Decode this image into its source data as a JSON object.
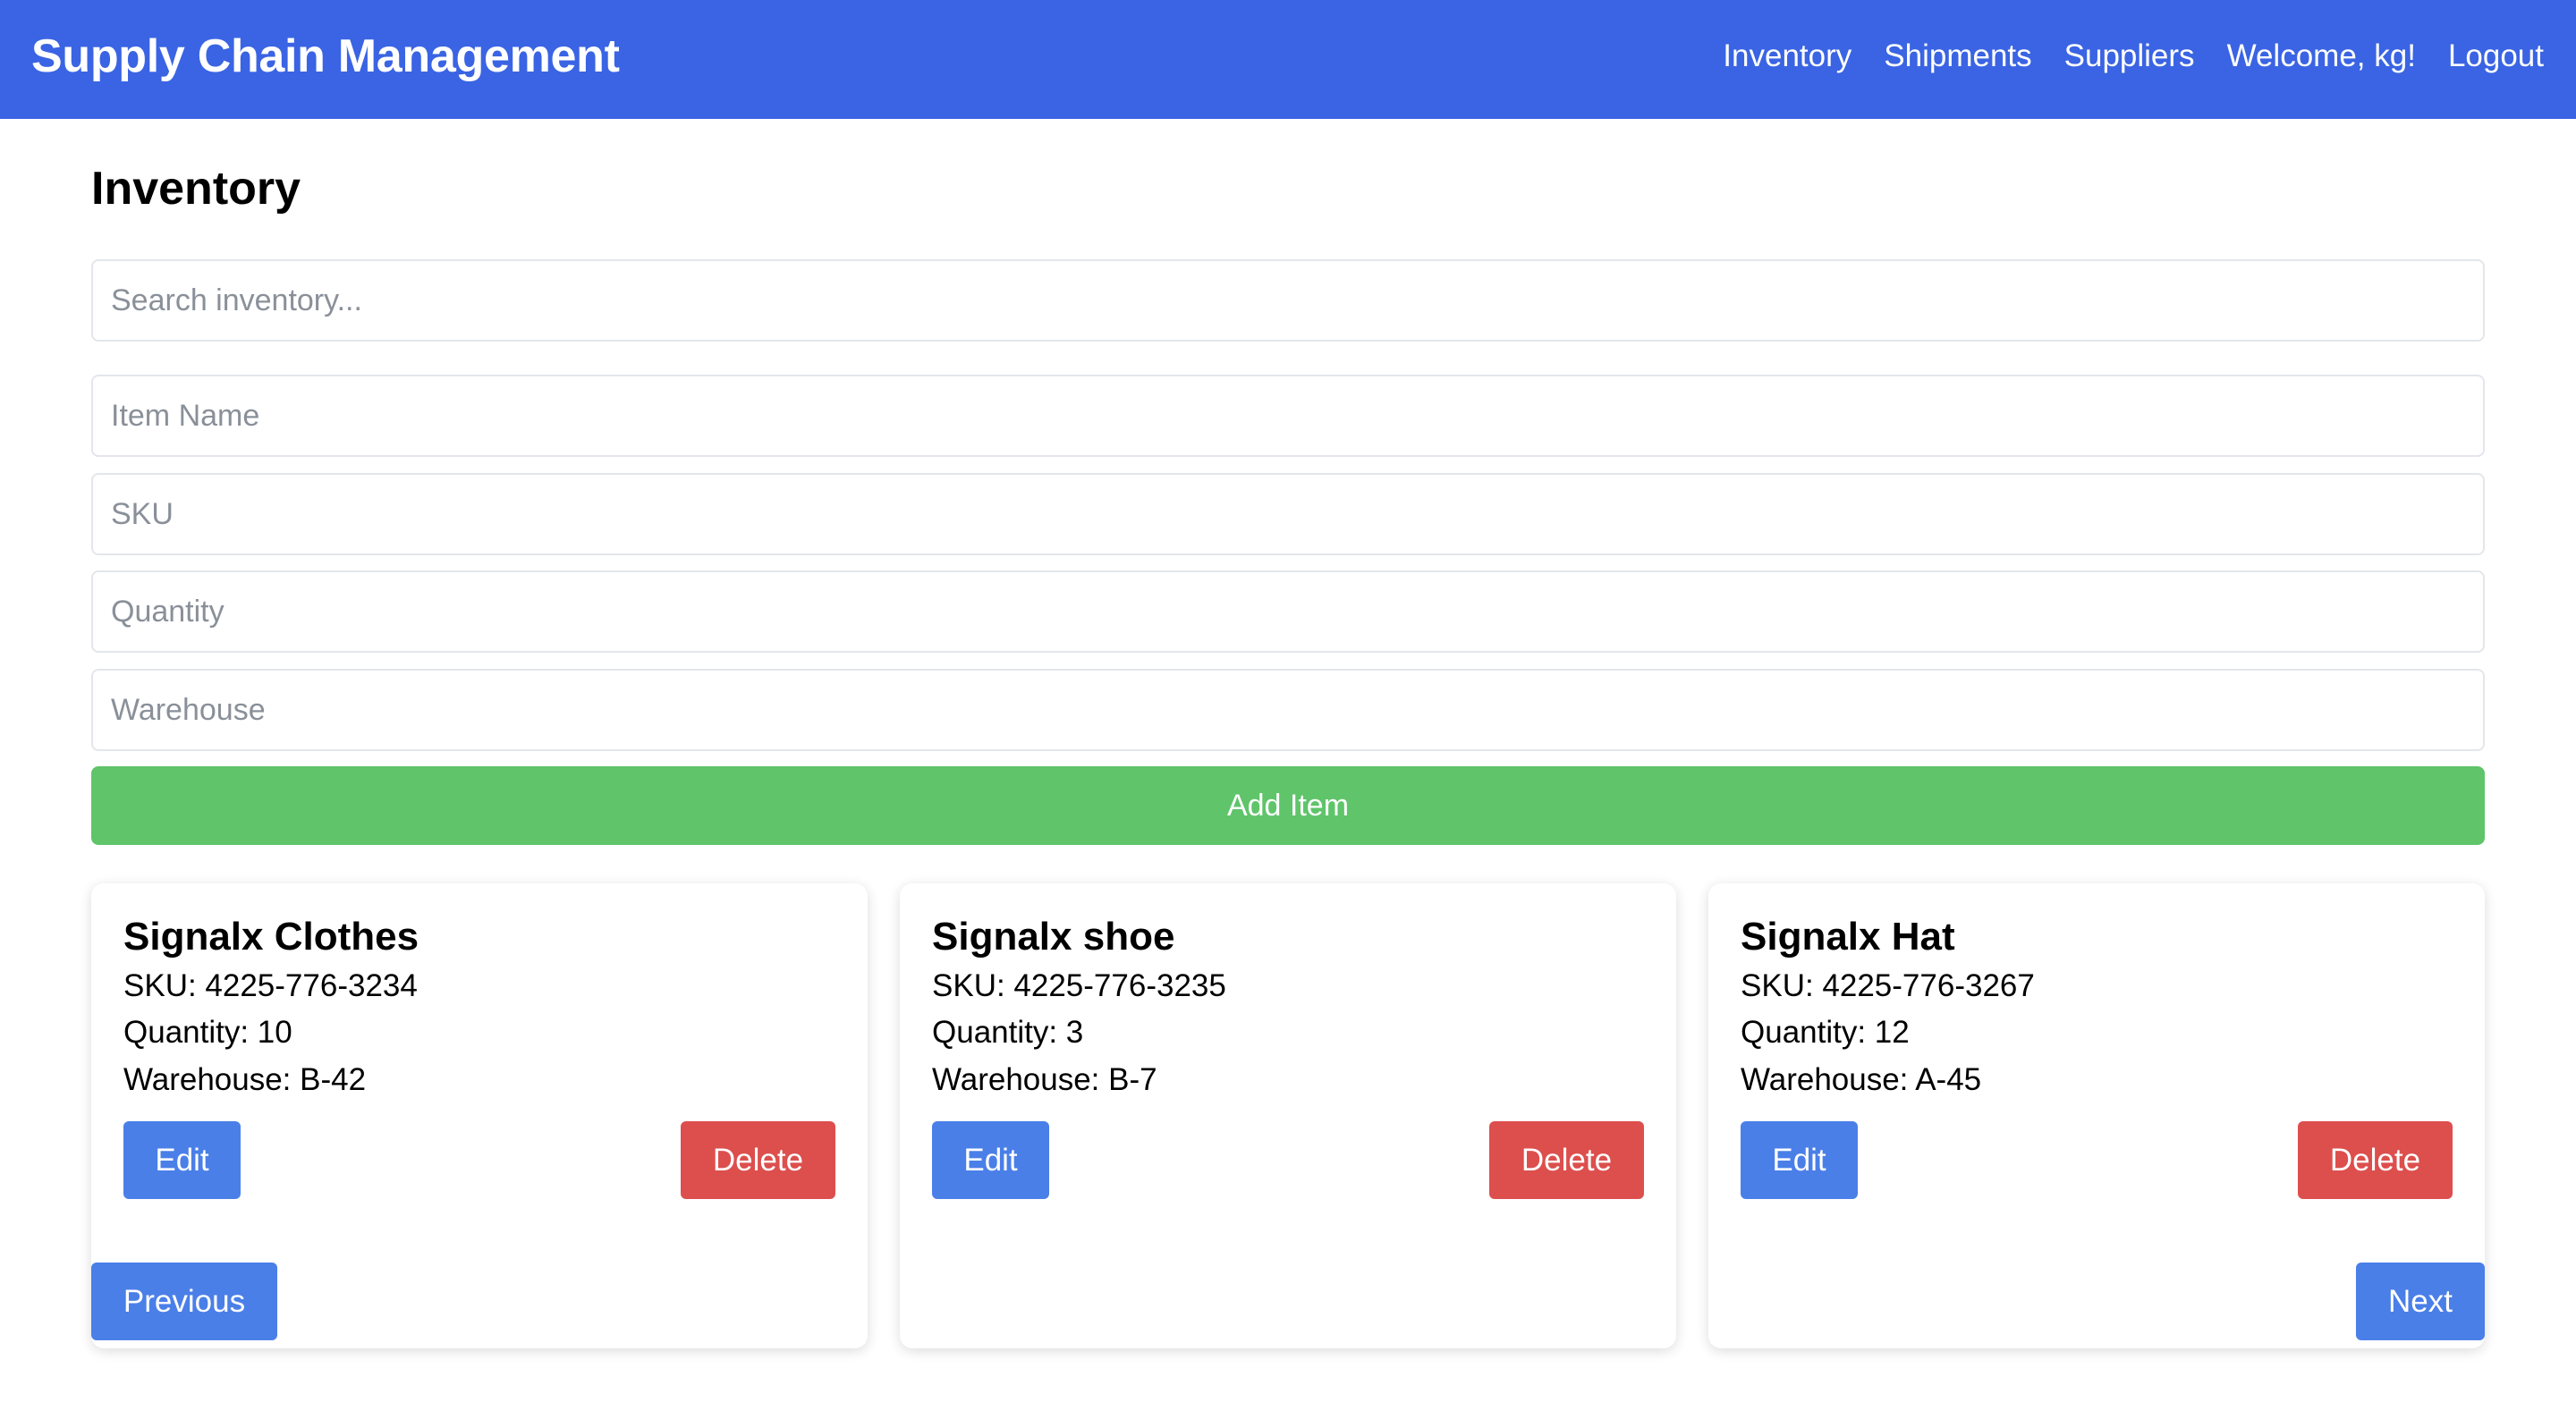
{
  "header": {
    "brand": "Supply Chain Management",
    "nav": [
      "Inventory",
      "Shipments",
      "Suppliers",
      "Welcome, kg!",
      "Logout"
    ],
    "background_color": "#3a64e3"
  },
  "page": {
    "title": "Inventory"
  },
  "search": {
    "placeholder": "Search inventory...",
    "value": ""
  },
  "form": {
    "item_name_placeholder": "Item Name",
    "sku_placeholder": "SKU",
    "quantity_placeholder": "Quantity",
    "warehouse_placeholder": "Warehouse",
    "add_button_label": "Add Item",
    "add_button_color": "#5fc46a"
  },
  "items": [
    {
      "name": "Signalx Clothes",
      "sku": "SKU: 4225-776-3234",
      "quantity": "Quantity: 10",
      "warehouse": "Warehouse: B-42",
      "edit_label": "Edit",
      "delete_label": "Delete"
    },
    {
      "name": "Signalx shoe",
      "sku": "SKU: 4225-776-3235",
      "quantity": "Quantity: 3",
      "warehouse": "Warehouse: B-7",
      "edit_label": "Edit",
      "delete_label": "Delete"
    },
    {
      "name": "Signalx Hat",
      "sku": "SKU: 4225-776-3267",
      "quantity": "Quantity: 12",
      "warehouse": "Warehouse: A-45",
      "edit_label": "Edit",
      "delete_label": "Delete"
    }
  ],
  "pagination": {
    "previous_label": "Previous",
    "next_label": "Next"
  },
  "colors": {
    "edit_button": "#4a7fe8",
    "delete_button": "#dc4f4d"
  }
}
